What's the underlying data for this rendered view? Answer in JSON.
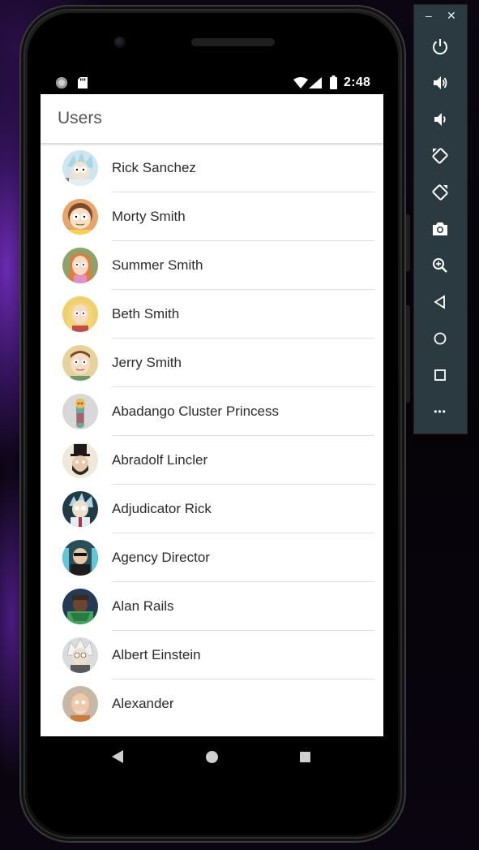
{
  "status_bar": {
    "time": "2:48"
  },
  "app_bar": {
    "title": "Users"
  },
  "users": [
    {
      "name": "Rick Sanchez",
      "avatar": "rick-sanchez-avatar"
    },
    {
      "name": "Morty Smith",
      "avatar": "morty-smith-avatar"
    },
    {
      "name": "Summer Smith",
      "avatar": "summer-smith-avatar"
    },
    {
      "name": "Beth Smith",
      "avatar": "beth-smith-avatar"
    },
    {
      "name": "Jerry Smith",
      "avatar": "jerry-smith-avatar"
    },
    {
      "name": "Abadango Cluster Princess",
      "avatar": "abadango-cluster-princess-avatar"
    },
    {
      "name": "Abradolf Lincler",
      "avatar": "abradolf-lincler-avatar"
    },
    {
      "name": "Adjudicator Rick",
      "avatar": "adjudicator-rick-avatar"
    },
    {
      "name": "Agency Director",
      "avatar": "agency-director-avatar"
    },
    {
      "name": "Alan Rails",
      "avatar": "alan-rails-avatar"
    },
    {
      "name": "Albert Einstein",
      "avatar": "albert-einstein-avatar"
    },
    {
      "name": "Alexander",
      "avatar": "alexander-avatar"
    }
  ],
  "nav_bar": {
    "icons": [
      "back-icon",
      "home-icon",
      "recent-apps-icon"
    ]
  },
  "emulator_toolbar": {
    "window_controls": {
      "minimize": "–",
      "close": "✕"
    },
    "more_label": "•••",
    "buttons": [
      "power-icon",
      "volume-up-icon",
      "volume-down-icon",
      "rotate-left-icon",
      "rotate-right-icon",
      "camera-icon",
      "zoom-icon",
      "back-icon",
      "home-icon",
      "overview-icon",
      "more-icon"
    ]
  },
  "colors": {
    "toolbar_bg": "#2b3a40",
    "screen_bg": "#ffffff",
    "title_text": "#555555",
    "item_text": "#2b2b2b",
    "divider": "#dedede"
  }
}
